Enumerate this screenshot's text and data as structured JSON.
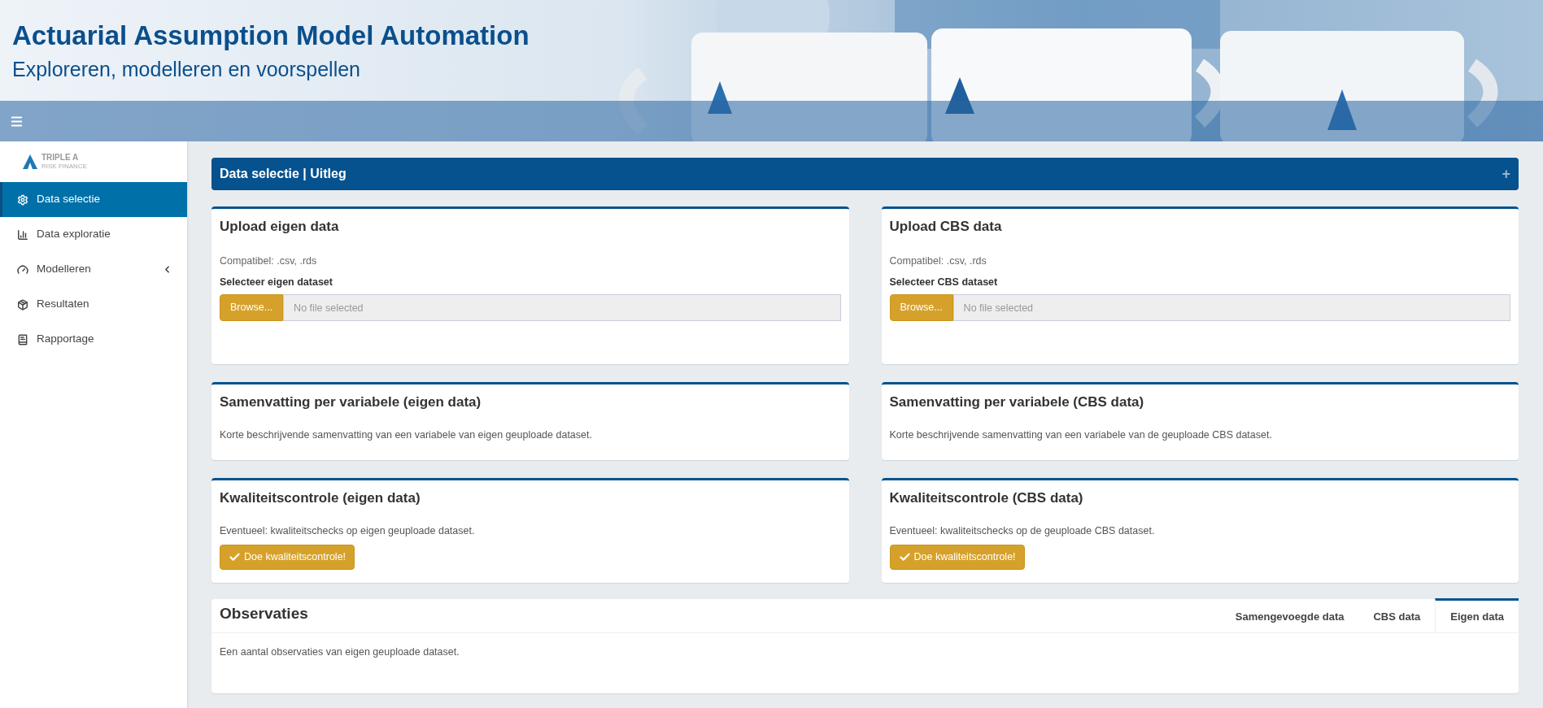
{
  "header": {
    "title": "Actuarial Assumption Model Automation",
    "subtitle": "Exploreren, modelleren en voorspellen"
  },
  "sidebar": {
    "logo": {
      "name": "TRIPLE A",
      "tagline": "RISK FINANCE"
    },
    "items": [
      {
        "label": "Data selectie",
        "selected": true,
        "has_submenu": false
      },
      {
        "label": "Data exploratie",
        "selected": false,
        "has_submenu": false
      },
      {
        "label": "Modelleren",
        "selected": false,
        "has_submenu": true
      },
      {
        "label": "Resultaten",
        "selected": false,
        "has_submenu": false
      },
      {
        "label": "Rapportage",
        "selected": false,
        "has_submenu": false
      }
    ]
  },
  "explanation_box": {
    "title": "Data selectie | Uitleg",
    "toggle": "+"
  },
  "panels": [
    {
      "kind": "upload",
      "title": "Upload eigen data",
      "hint": "Compatibel: .csv, .rds",
      "label": "Selecteer eigen dataset",
      "button": "Browse...",
      "placeholder": "No file selected"
    },
    {
      "kind": "upload",
      "title": "Upload CBS data",
      "hint": "Compatibel: .csv, .rds",
      "label": "Selecteer CBS dataset",
      "button": "Browse...",
      "placeholder": "No file selected"
    },
    {
      "kind": "summary",
      "title": "Samenvatting per variabele (eigen data)",
      "text": "Korte beschrijvende samenvatting van een variabele van eigen geuploade dataset."
    },
    {
      "kind": "summary",
      "title": "Samenvatting per variabele (CBS data)",
      "text": "Korte beschrijvende samenvatting van een variabele van de geuploade CBS dataset."
    },
    {
      "kind": "quality",
      "title": "Kwaliteitscontrole (eigen data)",
      "text": "Eventueel: kwaliteitschecks op eigen geuploade dataset.",
      "button": "Doe kwaliteitscontrole!"
    },
    {
      "kind": "quality",
      "title": "Kwaliteitscontrole (CBS data)",
      "text": "Eventueel: kwaliteitschecks op de geuploade CBS dataset.",
      "button": "Doe kwaliteitscontrole!"
    }
  ],
  "observations": {
    "title": "Observaties",
    "tabs": [
      {
        "label": "Samengevoegde data",
        "selected": false
      },
      {
        "label": "CBS data",
        "selected": false
      },
      {
        "label": "Eigen data",
        "selected": true
      }
    ],
    "text": "Een aantal observaties van eigen geuploade dataset."
  }
}
